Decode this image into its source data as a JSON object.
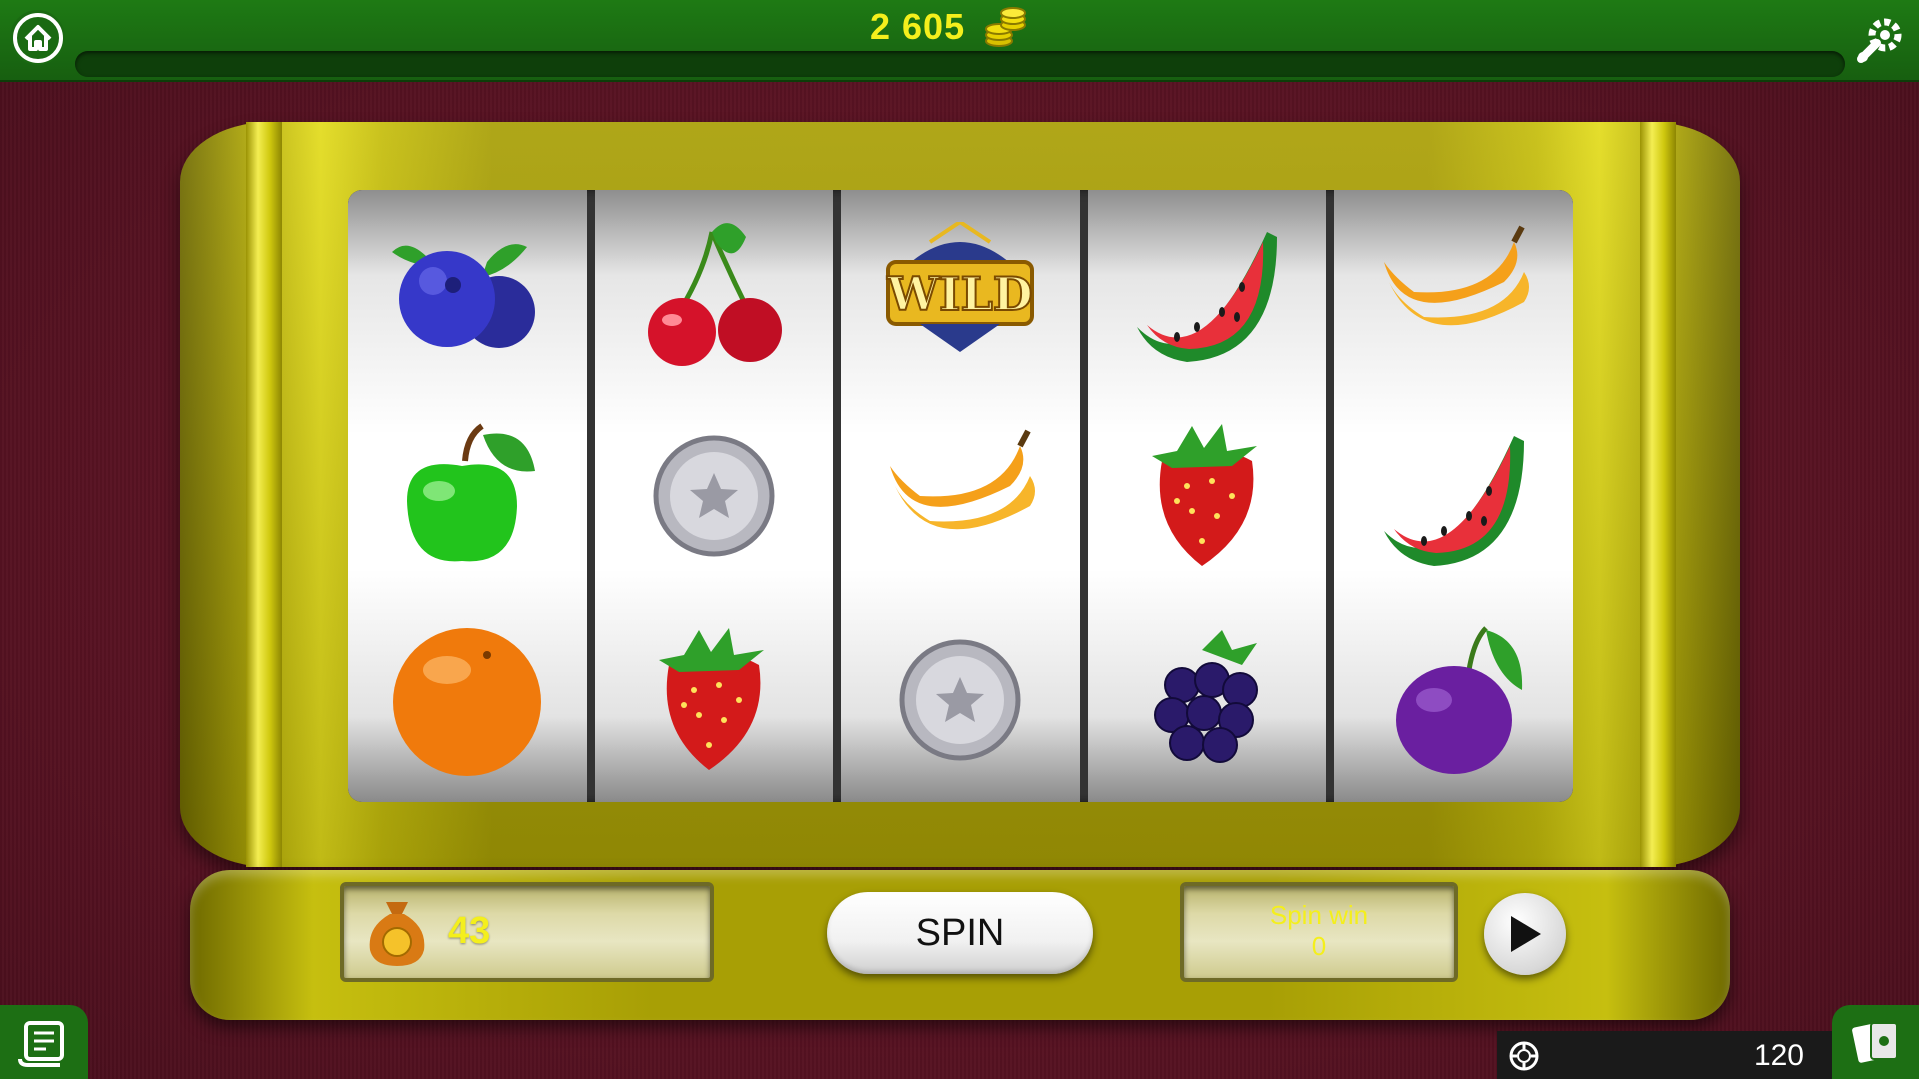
{
  "header": {
    "balance": "2 605",
    "balance_icon": "coin-stack-icon",
    "home_icon": "home-icon",
    "settings_icon": "wrench-gear-icon"
  },
  "reels": [
    [
      "blueberry",
      "green-apple",
      "orange"
    ],
    [
      "cherry",
      "silver-star-coin",
      "strawberry"
    ],
    [
      "wild",
      "banana",
      "silver-star-coin"
    ],
    [
      "watermelon",
      "strawberry",
      "blackberry"
    ],
    [
      "banana",
      "watermelon",
      "plum"
    ]
  ],
  "wild_label": "WILD",
  "controls": {
    "bet_value": "43",
    "bet_icon": "money-bag-icon",
    "spin_label": "SPIN",
    "spin_win_label": "Spin win",
    "spin_win_value": "0",
    "play_icon": "play-icon"
  },
  "footer": {
    "counter_value": "120",
    "counter_icon": "chip-icon",
    "log_icon": "scroll-icon",
    "cards_icon": "cards-icon"
  },
  "colors": {
    "accent_yellow": "#f4ef1c",
    "bar_green": "#1e7a14",
    "background_maroon": "#561222",
    "machine_gold": "#c5bd0b"
  }
}
